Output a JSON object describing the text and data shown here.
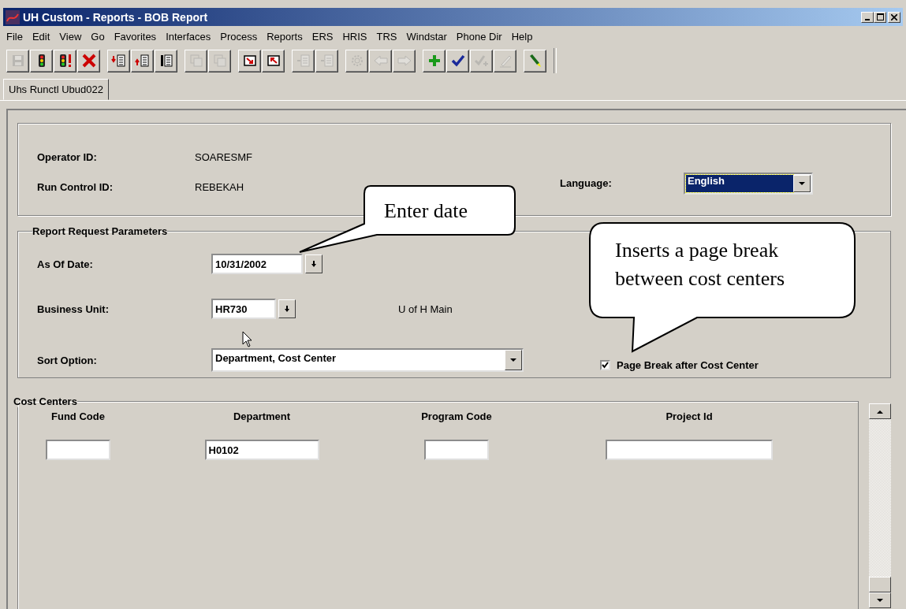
{
  "window": {
    "title": "UH Custom - Reports - BOB Report"
  },
  "menu": [
    "File",
    "Edit",
    "View",
    "Go",
    "Favorites",
    "Interfaces",
    "Process",
    "Reports",
    "ERS",
    "HRIS",
    "TRS",
    "Windstar",
    "Phone Dir",
    "Help"
  ],
  "toolbar": [
    [
      {
        "kind": "save",
        "disabled": true
      },
      {
        "kind": "signal",
        "disabled": false
      },
      {
        "kind": "signal-alert",
        "disabled": false
      },
      {
        "kind": "delete",
        "disabled": false
      }
    ],
    [
      {
        "kind": "insert-down",
        "disabled": false
      },
      {
        "kind": "insert-up",
        "disabled": false
      },
      {
        "kind": "list",
        "disabled": false
      }
    ],
    [
      {
        "kind": "copy-down",
        "disabled": true
      },
      {
        "kind": "copy-up",
        "disabled": true
      }
    ],
    [
      {
        "kind": "arrow-in",
        "disabled": false
      },
      {
        "kind": "arrow-out",
        "disabled": false
      }
    ],
    [
      {
        "kind": "insert-row",
        "disabled": true
      },
      {
        "kind": "delete-row",
        "disabled": true
      }
    ],
    [
      {
        "kind": "gear",
        "disabled": true
      },
      {
        "kind": "back",
        "disabled": true
      },
      {
        "kind": "forward",
        "disabled": true
      }
    ],
    [
      {
        "kind": "add",
        "disabled": false
      },
      {
        "kind": "check",
        "disabled": false
      },
      {
        "kind": "check-add",
        "disabled": true
      },
      {
        "kind": "pencil",
        "disabled": true
      }
    ],
    [
      {
        "kind": "highlighter",
        "disabled": false
      }
    ]
  ],
  "tabs": [
    {
      "label": "Uhs Runctl Ubud022",
      "selected": true
    }
  ],
  "header": {
    "operator_label": "Operator ID:",
    "operator_value": "SOARESMF",
    "run_control_label": "Run Control ID:",
    "run_control_value": "REBEKAH",
    "language_label": "Language:",
    "language_value": "English"
  },
  "parameters": {
    "title": "Report Request Parameters",
    "as_of_date_label": "As Of Date:",
    "as_of_date": "10/31/2002",
    "business_unit_label": "Business Unit:",
    "business_unit": "HR730",
    "business_unit_name": "U of H Main",
    "sort_label": "Sort Option:",
    "sort_value": "Department, Cost Center",
    "page_break_label": "Page Break after Cost Center",
    "page_break_checked": true
  },
  "cost_centers": {
    "title": "Cost Centers",
    "columns": [
      {
        "label": "Fund Code"
      },
      {
        "label": "Department",
        "value": "H0102"
      },
      {
        "label": "Program Code"
      },
      {
        "label": "Project Id"
      }
    ]
  },
  "callouts": [
    {
      "text": "Enter date"
    },
    {
      "text": "Inserts a page break between cost centers"
    }
  ]
}
